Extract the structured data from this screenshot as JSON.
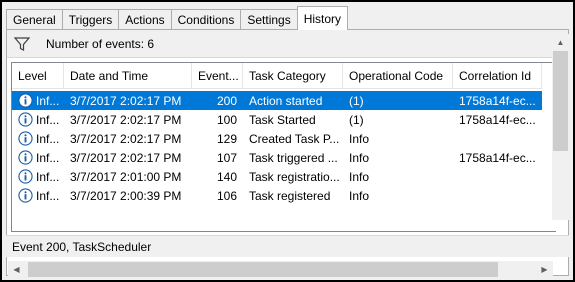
{
  "tabs": [
    {
      "label": "General"
    },
    {
      "label": "Triggers"
    },
    {
      "label": "Actions"
    },
    {
      "label": "Conditions"
    },
    {
      "label": "Settings"
    },
    {
      "label": "History",
      "active": true
    }
  ],
  "filter": {
    "label": "Number of events: 6"
  },
  "columns": [
    "Level",
    "Date and Time",
    "Event...",
    "Task Category",
    "Operational Code",
    "Correlation Id"
  ],
  "rows": [
    {
      "level": "Inf...",
      "date": "3/7/2017 2:02:17 PM",
      "event": "200",
      "category": "Action started",
      "op": "(1)",
      "corr": "1758a14f-ec...",
      "selected": true
    },
    {
      "level": "Inf...",
      "date": "3/7/2017 2:02:17 PM",
      "event": "100",
      "category": "Task Started",
      "op": "(1)",
      "corr": "1758a14f-ec..."
    },
    {
      "level": "Inf...",
      "date": "3/7/2017 2:02:17 PM",
      "event": "129",
      "category": "Created Task P...",
      "op": "Info",
      "corr": ""
    },
    {
      "level": "Inf...",
      "date": "3/7/2017 2:02:17 PM",
      "event": "107",
      "category": "Task triggered ...",
      "op": "Info",
      "corr": "1758a14f-ec..."
    },
    {
      "level": "Inf...",
      "date": "3/7/2017 2:01:00 PM",
      "event": "140",
      "category": "Task registratio...",
      "op": "Info",
      "corr": ""
    },
    {
      "level": "Inf...",
      "date": "3/7/2017 2:00:39 PM",
      "event": "106",
      "category": "Task registered",
      "op": "Info",
      "corr": ""
    }
  ],
  "status": {
    "text": "Event 200, TaskScheduler"
  },
  "colors": {
    "selection": "#0078d7",
    "info_icon": "#1f5fa8"
  }
}
